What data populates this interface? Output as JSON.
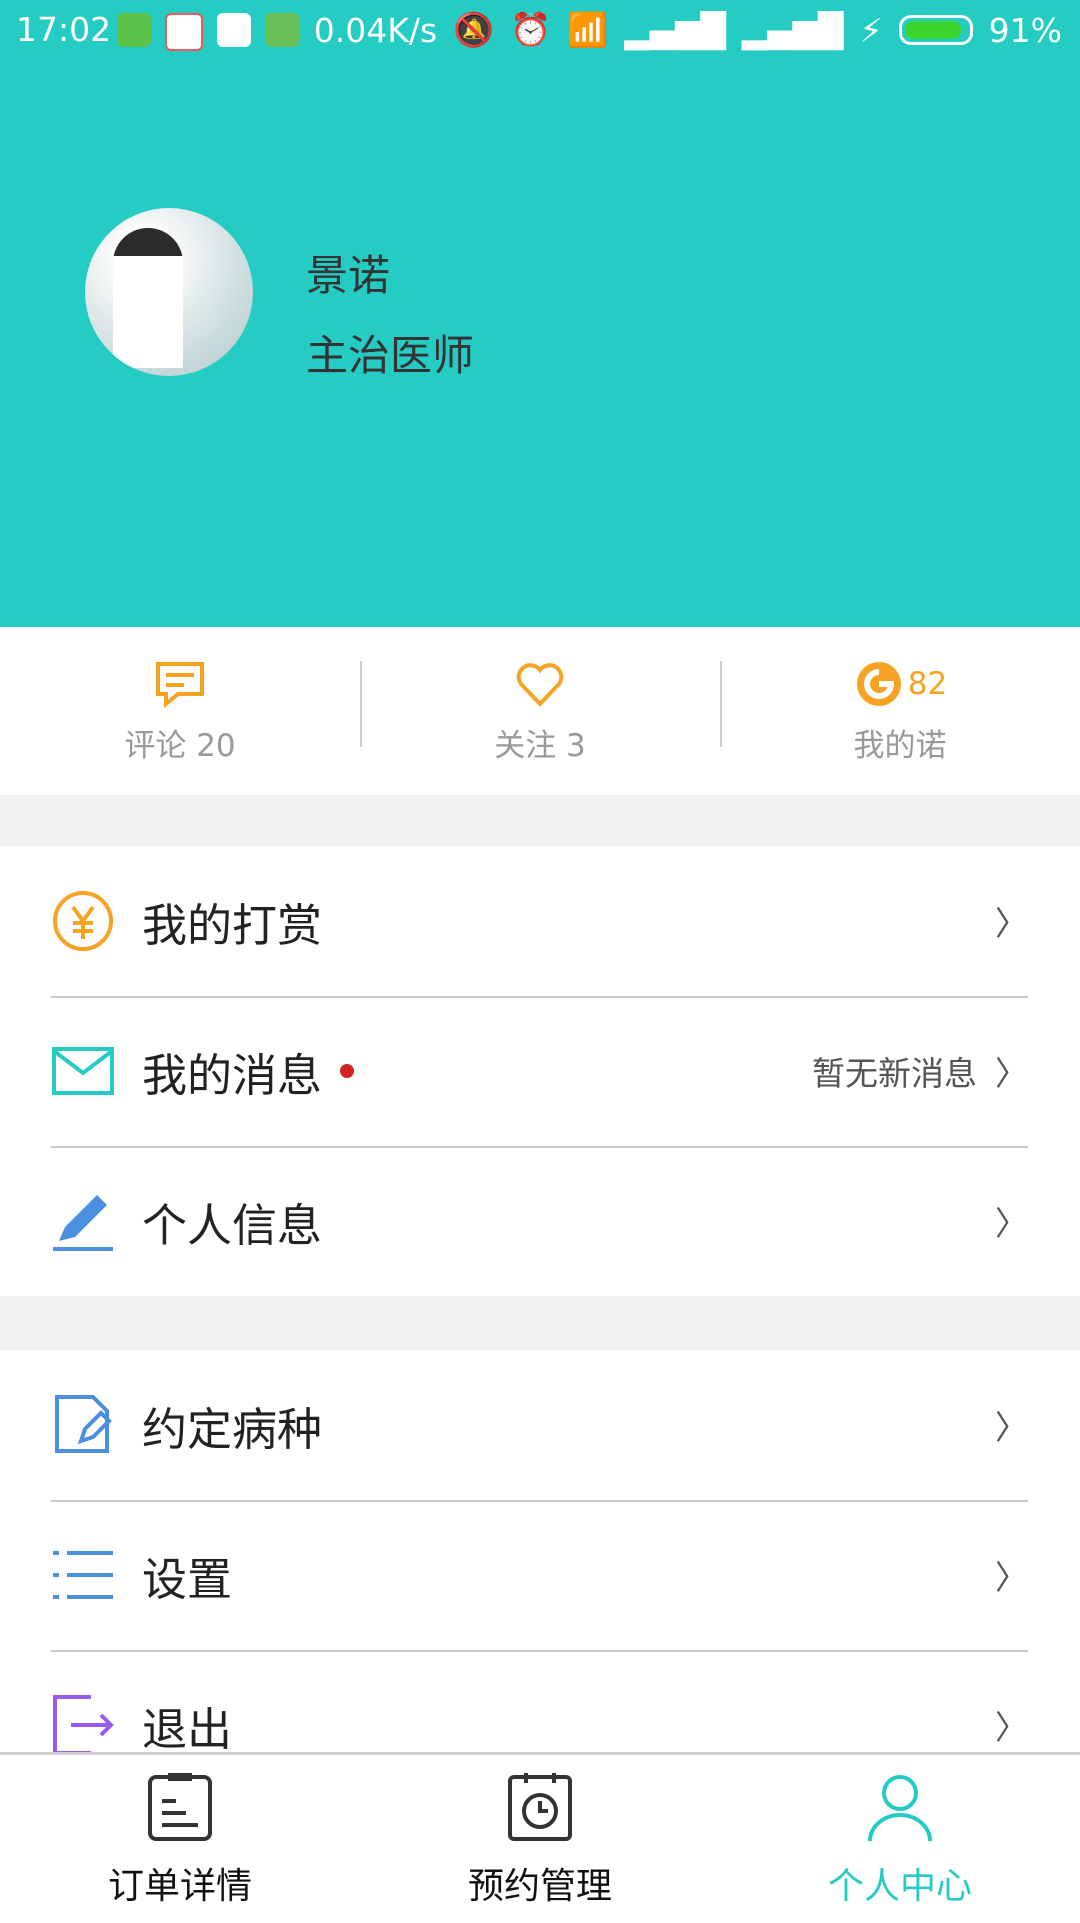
{
  "status_bar": {
    "time": "17:02",
    "speed": "0.04K/s",
    "battery": "91%",
    "app_icon_colors": [
      "#5bc24a",
      "#f25b5b",
      "#f7c34a",
      "#6bbf59"
    ]
  },
  "profile": {
    "name": "景诺",
    "title": "主治医师"
  },
  "stats": {
    "comments": "评论 20",
    "follows": "关注 3",
    "points_value": "82",
    "points_label": "我的诺"
  },
  "menu_group_1": [
    {
      "label": "我的打赏",
      "icon": "yen-icon"
    },
    {
      "label": "我的消息",
      "icon": "mail-icon",
      "status": "暂无新消息"
    },
    {
      "label": "个人信息",
      "icon": "pen-icon"
    }
  ],
  "menu_group_2": [
    {
      "label": "约定病种",
      "icon": "document-edit-icon"
    },
    {
      "label": "设置",
      "icon": "list-icon"
    },
    {
      "label": "退出",
      "icon": "exit-icon"
    }
  ],
  "bottom_nav": [
    {
      "label": "订单详情",
      "icon": "clipboard-icon"
    },
    {
      "label": "预约管理",
      "icon": "calendar-history-icon"
    },
    {
      "label": "个人中心",
      "icon": "user-icon",
      "active": true
    }
  ],
  "colors": {
    "accent": "#24ccc4",
    "orange": "#f6a324",
    "blue": "#4c8fe0",
    "purple": "#9a5af0",
    "red_dot": "#d42323"
  }
}
